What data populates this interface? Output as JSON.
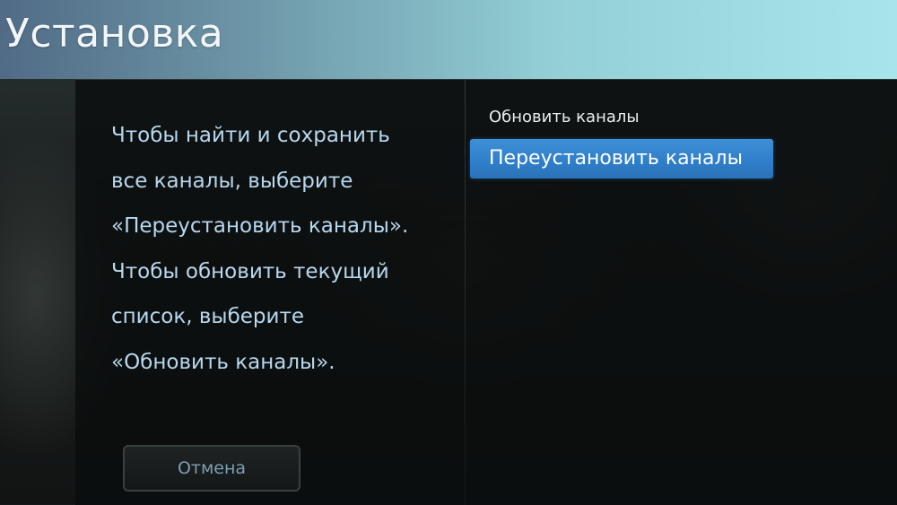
{
  "header": {
    "title": "Установка"
  },
  "info": {
    "lines": [
      "Чтобы найти и сохранить",
      "все каналы, выберите",
      "«Переустановить каналы».",
      "Чтобы обновить текущий",
      "список, выберите",
      "«Обновить каналы»."
    ]
  },
  "menu": {
    "items": [
      {
        "label": "Обновить каналы",
        "selected": false
      },
      {
        "label": "Переустановить каналы",
        "selected": true
      }
    ]
  },
  "cancel_button": {
    "label": "Отмена"
  },
  "colors": {
    "header_gradient_start": "#516b86",
    "header_gradient_end": "#a6e6ea",
    "info_text": "#b7d8ef",
    "selected_item": "#2f7fcb",
    "cancel_text": "#7d9fb6"
  }
}
